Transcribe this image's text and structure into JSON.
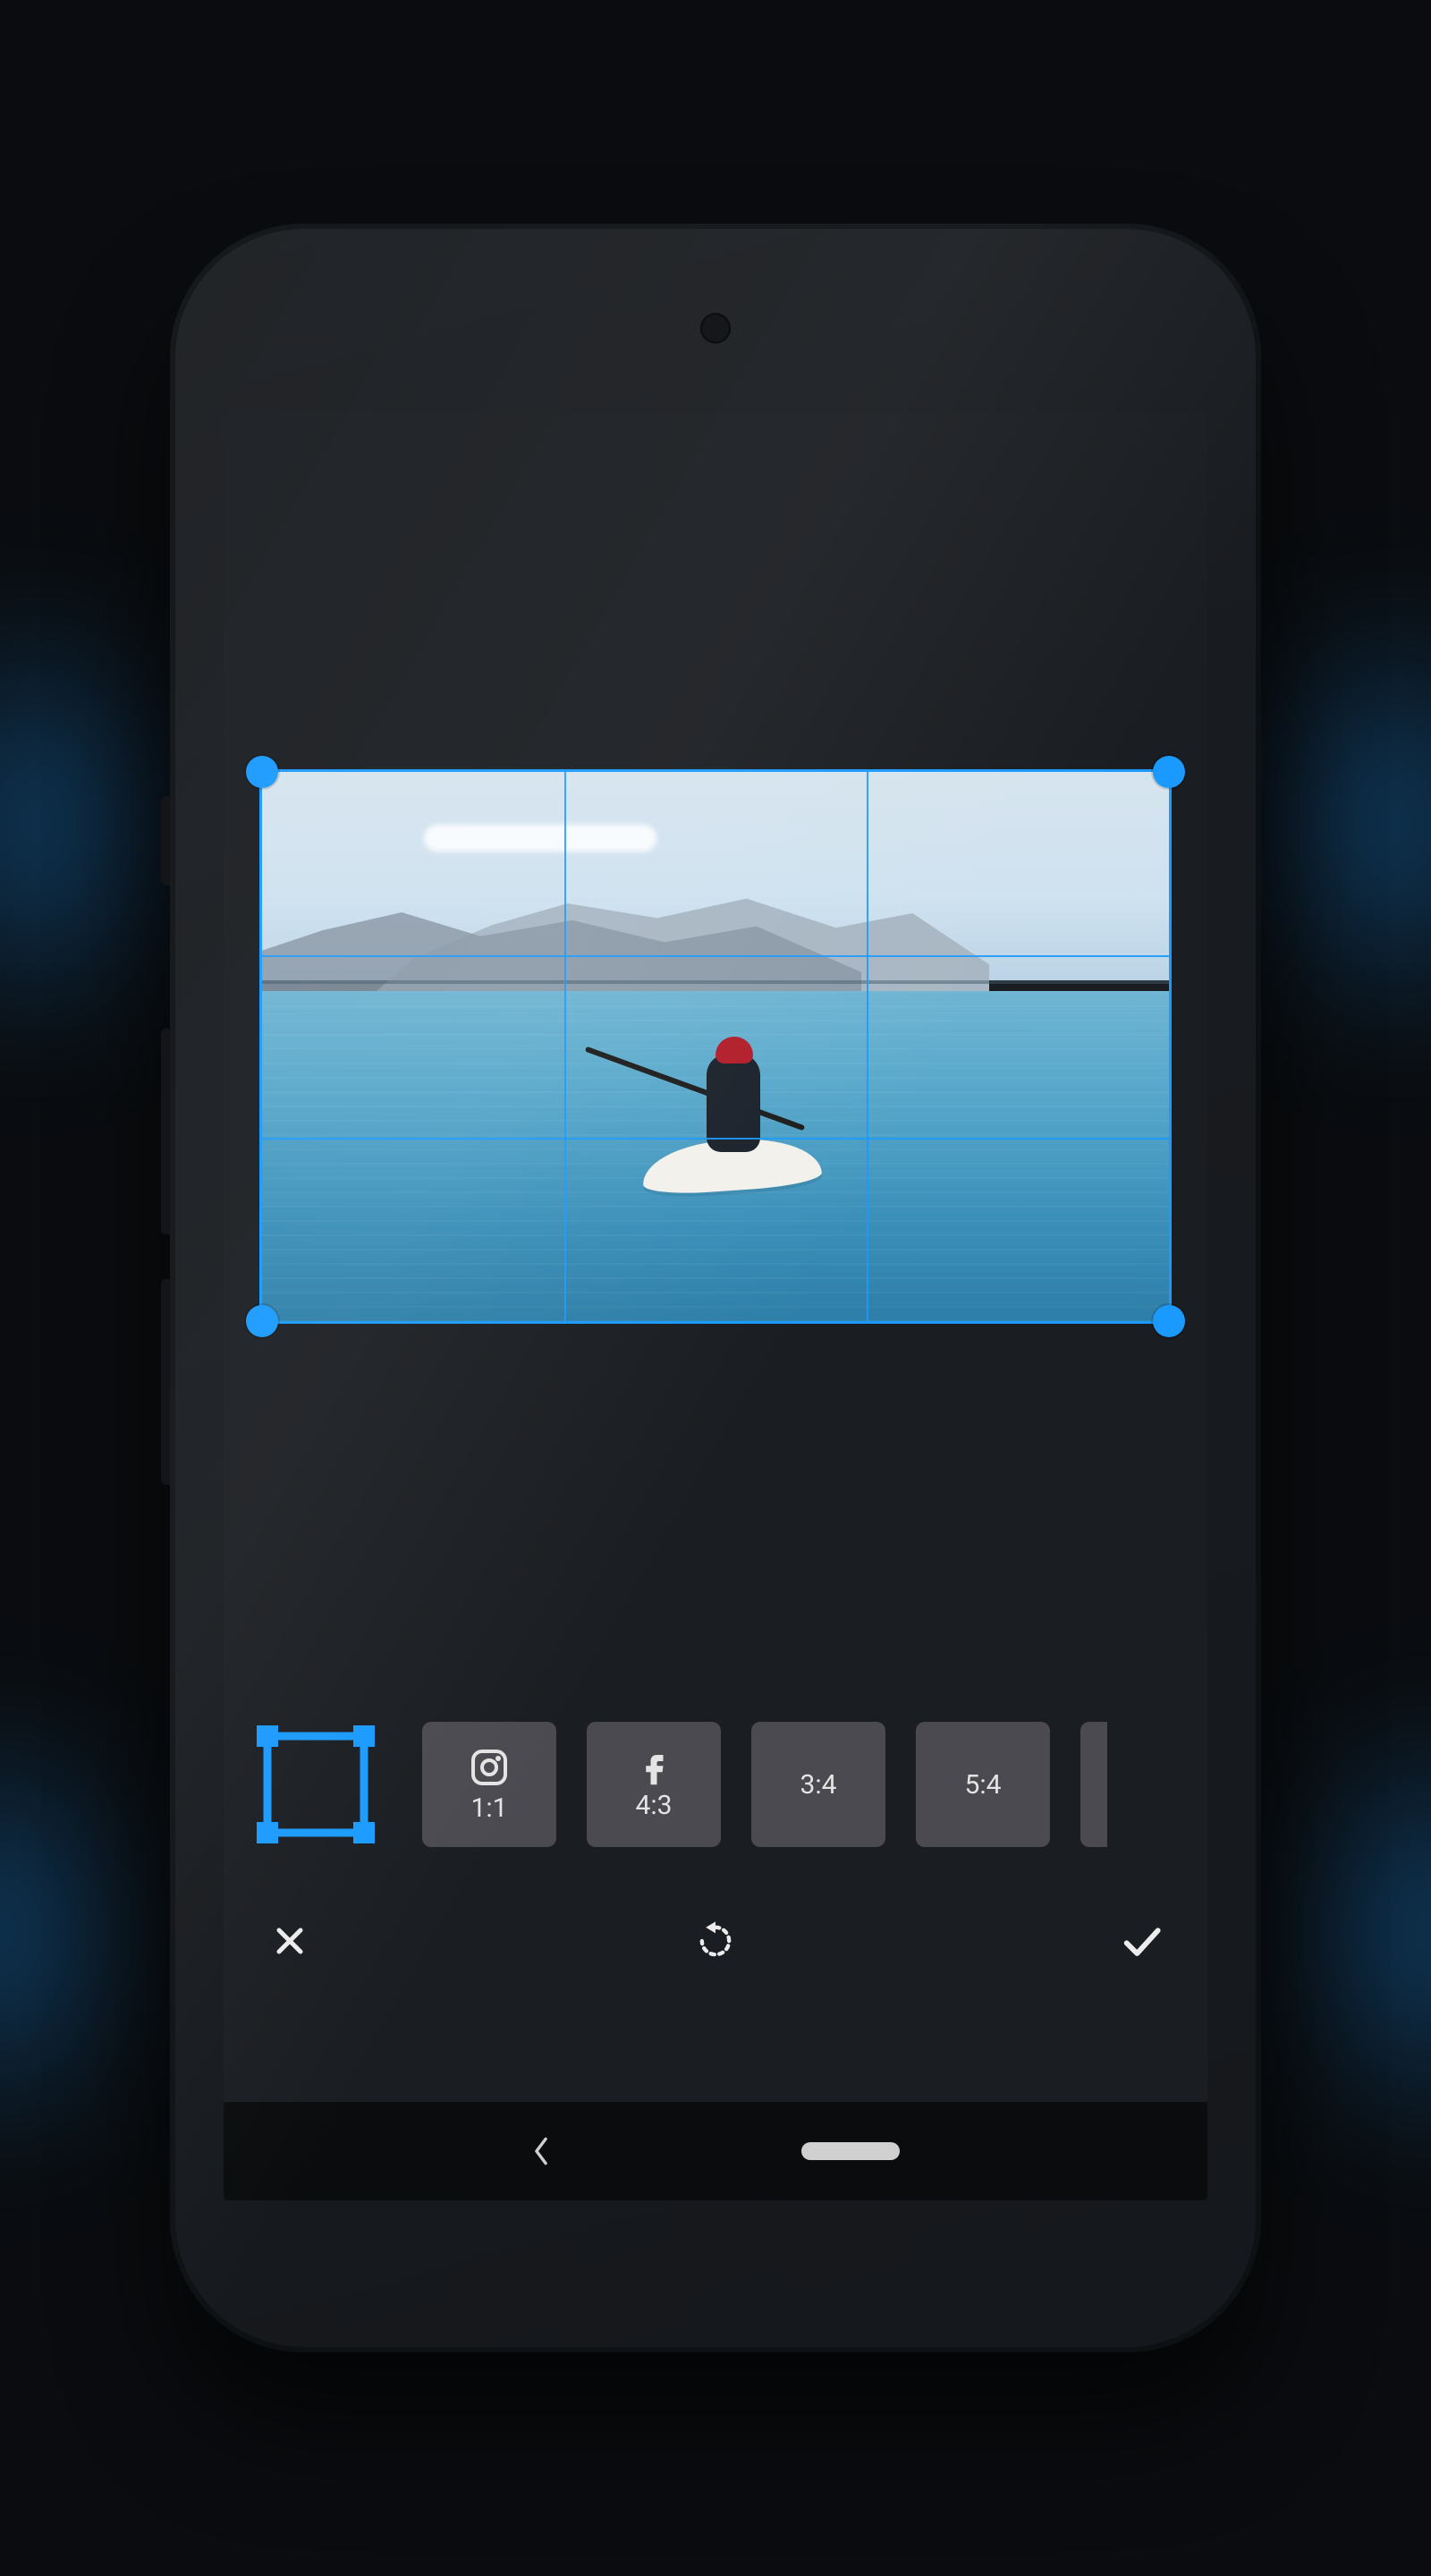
{
  "accent_color": "#1a9aff",
  "crop": {
    "grid": "rule-of-thirds",
    "handles": 4
  },
  "ratios": {
    "selected_index": 0,
    "items": [
      {
        "id": "free",
        "label": ""
      },
      {
        "id": "ig-1-1",
        "label": "1:1"
      },
      {
        "id": "fb-4-3",
        "label": "4:3"
      },
      {
        "id": "3-4",
        "label": "3:4"
      },
      {
        "id": "5-4",
        "label": "5:4"
      }
    ]
  },
  "actions": {
    "cancel": "Cancel",
    "reset": "Reset",
    "apply": "Apply"
  },
  "nav": {
    "back": "Back",
    "home": "Home"
  }
}
